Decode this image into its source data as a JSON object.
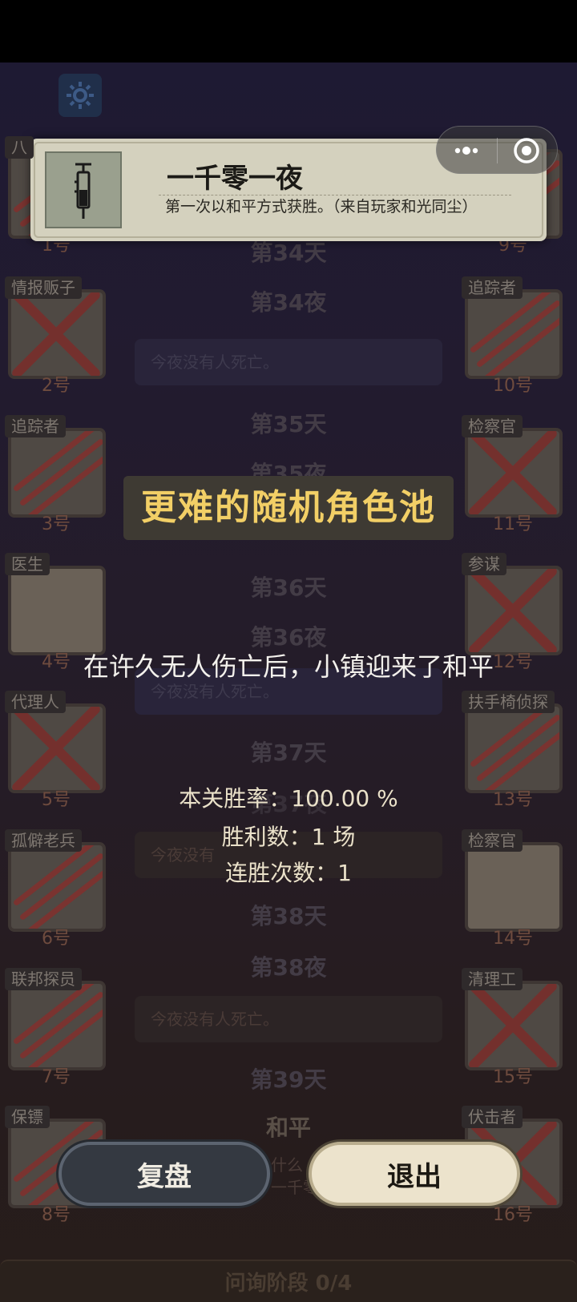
{
  "players": {
    "left": [
      {
        "role": "八",
        "number": "1号",
        "state": "clawed"
      },
      {
        "role": "情报贩子",
        "number": "2号",
        "state": "crossed"
      },
      {
        "role": "追踪者",
        "number": "3号",
        "state": "clawed"
      },
      {
        "role": "医生",
        "number": "4号",
        "state": "alive"
      },
      {
        "role": "代理人",
        "number": "5号",
        "state": "crossed"
      },
      {
        "role": "孤僻老兵",
        "number": "6号",
        "state": "clawed"
      },
      {
        "role": "联邦探员",
        "number": "7号",
        "state": "clawed"
      },
      {
        "role": "保镖",
        "number": "8号",
        "state": "clawed"
      }
    ],
    "right": [
      {
        "role": "",
        "number": "9号",
        "state": "clawed"
      },
      {
        "role": "追踪者",
        "number": "10号",
        "state": "clawed"
      },
      {
        "role": "检察官",
        "number": "11号",
        "state": "crossed"
      },
      {
        "role": "参谋",
        "number": "12号",
        "state": "crossed"
      },
      {
        "role": "扶手椅侦探",
        "number": "13号",
        "state": "clawed"
      },
      {
        "role": "检察官",
        "number": "14号",
        "state": "alive"
      },
      {
        "role": "清理工",
        "number": "15号",
        "state": "crossed"
      },
      {
        "role": "伏击者",
        "number": "16号",
        "state": "crossed"
      }
    ]
  },
  "timeline": {
    "d34": "第34天",
    "n34": "第34夜",
    "msg_none_1": "今夜没有人死亡。",
    "d35": "第35天",
    "n35": "第35夜",
    "d36": "第36天",
    "n36": "第36夜",
    "msg_none_2": "今夜没有人死亡。",
    "d37": "第37天",
    "n37": "第37夜",
    "msg_none_3": "今夜没有",
    "d38": "第38天",
    "n38": "第38夜",
    "msg_none_4": "今夜没有人死亡。",
    "d39": "第39天",
    "peace": "和平",
    "msg_last_1": "什么",
    "msg_last_2": "一千零"
  },
  "achievement": {
    "title": "一千零一夜",
    "description": "第一次以和平方式获胜。（来自玩家和光同尘）",
    "icon": "syringe-icon"
  },
  "result": {
    "banner": "更难的随机角色池",
    "description": "在许久无人伤亡后，小镇迎来了和平",
    "win_rate": "本关胜率：100.00 %",
    "wins": "胜利数：1 场",
    "streak": "连胜次数：1"
  },
  "buttons": {
    "replay": "复盘",
    "exit": "退出"
  },
  "bottom_bar": "问询阶段 0/4",
  "colors": {
    "banner_text": "#f2cf66",
    "claw": "#7a3330",
    "exit_button": "#ece3cc",
    "replay_button": "#343941"
  }
}
